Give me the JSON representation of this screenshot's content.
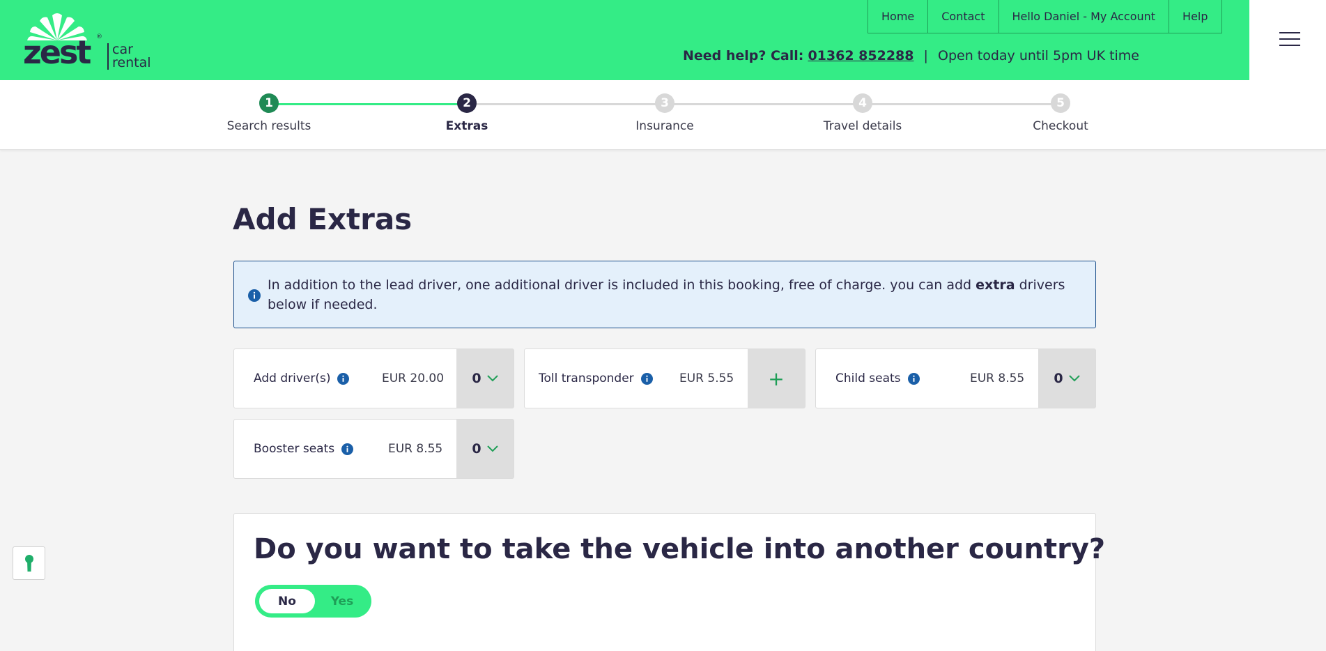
{
  "header": {
    "logo": {
      "word": "zest",
      "reg": "®",
      "line1": "car",
      "line2": "rental"
    },
    "nav": [
      "Home",
      "Contact",
      "Hello Daniel - My Account",
      "Help"
    ],
    "help_prefix": "Need help? Call:",
    "help_phone": "01362 852288",
    "help_sep": "|",
    "help_hours": "Open today until 5pm UK time"
  },
  "progress": {
    "steps": [
      {
        "num": "1",
        "label": "Search results",
        "state": "done"
      },
      {
        "num": "2",
        "label": "Extras",
        "state": "current"
      },
      {
        "num": "3",
        "label": "Insurance",
        "state": "todo"
      },
      {
        "num": "4",
        "label": "Travel details",
        "state": "todo"
      },
      {
        "num": "5",
        "label": "Checkout",
        "state": "todo"
      }
    ]
  },
  "main": {
    "title": "Add Extras",
    "notice": {
      "before": "In addition to the lead driver, one additional driver is included in this booking, free of charge. you can add",
      "bold": "extra",
      "after": "drivers below if needed."
    },
    "extras": [
      {
        "name": "Add driver(s)",
        "price": "EUR 20.00",
        "control": "0"
      },
      {
        "name": "Toll transponder",
        "price": "EUR 5.55",
        "control": "+"
      },
      {
        "name": "Child seats",
        "price": "EUR 8.55",
        "control": "0"
      },
      {
        "name": "Booster seats",
        "price": "EUR 8.55",
        "control": "0"
      }
    ],
    "country": {
      "question": "Do you want to take the vehicle into another country?",
      "no": "No",
      "yes": "Yes",
      "selected": "No"
    }
  },
  "colors": {
    "brand_green": "#34ec86",
    "navy": "#2a2745",
    "step_done": "#1f8a55",
    "info_blue": "#1a5fa8"
  }
}
